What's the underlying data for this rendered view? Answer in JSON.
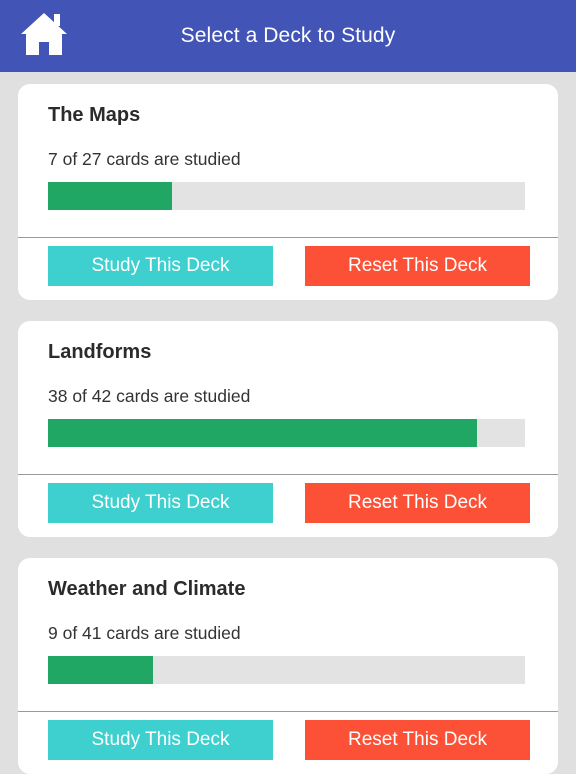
{
  "header": {
    "title": "Select a Deck to Study",
    "home_icon": "home-icon",
    "color": "#4254b5"
  },
  "colors": {
    "progress_fill": "#21a764",
    "progress_track": "#e2e3e2",
    "study_button": "#3ecfcf",
    "reset_button": "#fc5136"
  },
  "decks": [
    {
      "title": "The Maps",
      "progress_text": "7 of 27 cards are studied",
      "progress_fraction": 0.26,
      "study_label": "Study This Deck",
      "reset_label": "Reset This Deck"
    },
    {
      "title": "Landforms",
      "progress_text": "38 of 42 cards are studied",
      "progress_fraction": 0.9,
      "study_label": "Study This Deck",
      "reset_label": "Reset This Deck"
    },
    {
      "title": "Weather and Climate",
      "progress_text": "9 of 41 cards are studied",
      "progress_fraction": 0.22,
      "study_label": "Study This Deck",
      "reset_label": "Reset This Deck"
    }
  ]
}
